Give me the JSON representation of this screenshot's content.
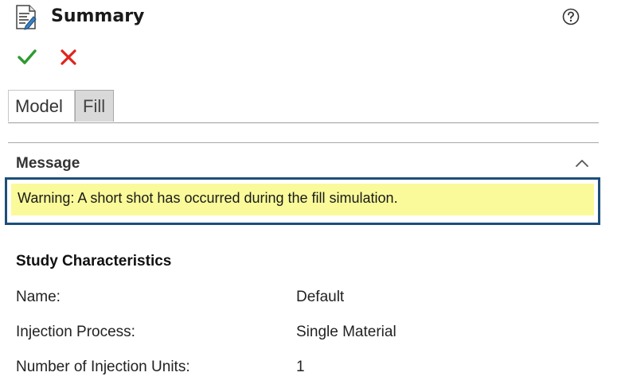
{
  "header": {
    "title": "Summary",
    "icon": "summary-document-icon",
    "help_icon": "help-circle-icon"
  },
  "actions": {
    "ok_icon": "checkmark-icon",
    "cancel_icon": "x-icon",
    "colors": {
      "ok": "#2e9a2e",
      "cancel": "#e0241b"
    }
  },
  "tabs": [
    {
      "label": "Model",
      "selected": true
    },
    {
      "label": "Fill",
      "selected": false
    }
  ],
  "message": {
    "heading": "Message",
    "text": "Warning: A short shot has occurred during the fill simulation.",
    "highlight_color": "#fafa9a",
    "border_color": "#1c4f7a"
  },
  "study": {
    "heading": "Study Characteristics",
    "rows": [
      {
        "label": "Name:",
        "value": "Default"
      },
      {
        "label": "Injection Process:",
        "value": "Single Material"
      },
      {
        "label": "Number of Injection Units:",
        "value": "1"
      }
    ]
  }
}
